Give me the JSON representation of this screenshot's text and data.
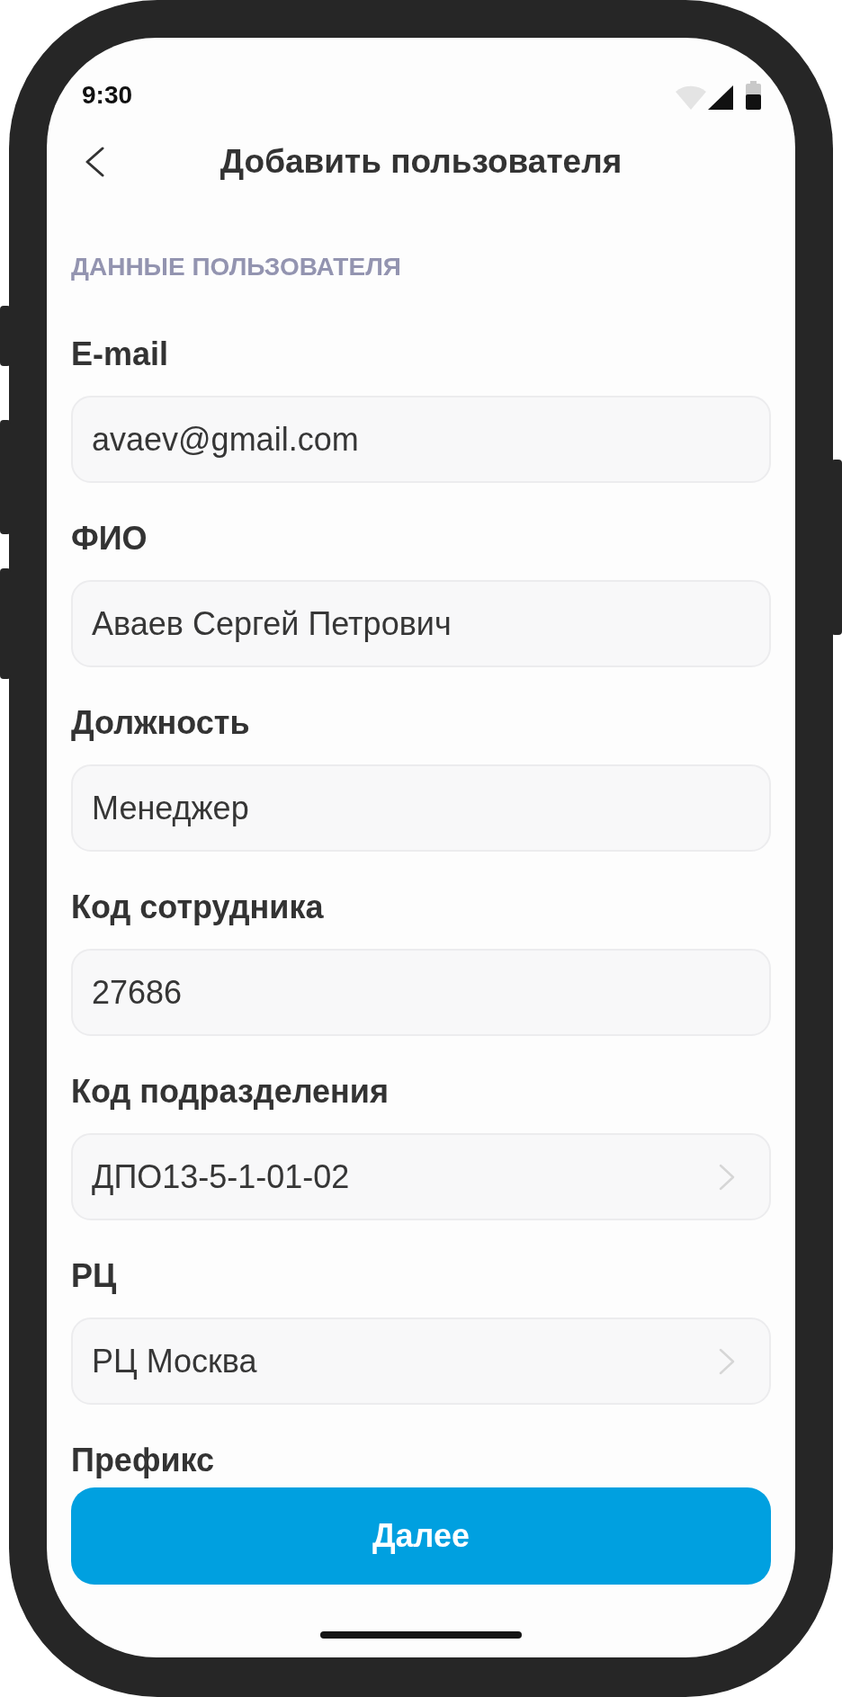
{
  "status_bar": {
    "time": "9:30"
  },
  "header": {
    "title": "Добавить пользователя"
  },
  "section": {
    "title": "ДАННЫЕ ПОЛЬЗОВАТЕЛЯ"
  },
  "fields": [
    {
      "label": "E-mail",
      "value": "avaev@gmail.com",
      "kind": "text"
    },
    {
      "label": "ФИО",
      "value": "Аваев Сергей Петрович",
      "kind": "text"
    },
    {
      "label": "Должность",
      "value": "Менеджер",
      "kind": "text"
    },
    {
      "label": "Код сотрудника",
      "value": "27686",
      "kind": "text"
    },
    {
      "label": "Код подразделения",
      "value": "ДПО13-5-1-01-02",
      "kind": "select"
    },
    {
      "label": "РЦ",
      "value": "РЦ Москва",
      "kind": "select"
    }
  ],
  "cut_off_field": {
    "label": "Префикс"
  },
  "button": {
    "label": "Далее"
  }
}
